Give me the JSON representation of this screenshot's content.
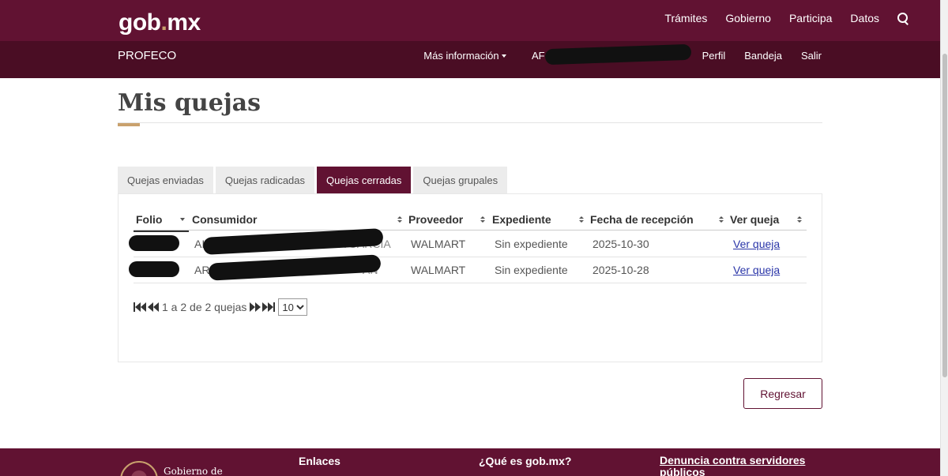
{
  "header": {
    "logo_main": "gob",
    "logo_dot": ".",
    "logo_tld": "mx",
    "nav": [
      "Trámites",
      "Gobierno",
      "Participa",
      "Datos"
    ],
    "search_icon": "search-icon"
  },
  "subheader": {
    "brand": "PROFECO",
    "mas_info": "Más información",
    "user_prefix": "AF",
    "items": [
      "Perfil",
      "Bandeja",
      "Salir"
    ]
  },
  "page": {
    "title": "Mis quejas"
  },
  "tabs": [
    {
      "label": "Quejas enviadas",
      "active": false
    },
    {
      "label": "Quejas radicadas",
      "active": false
    },
    {
      "label": "Quejas cerradas",
      "active": true
    },
    {
      "label": "Quejas grupales",
      "active": false
    }
  ],
  "table": {
    "headers": [
      "Folio",
      "Consumidor",
      "Proveedor",
      "Expediente",
      "Fecha de recepción",
      "Ver queja"
    ],
    "rows": [
      {
        "folio": "",
        "consumidor_prefix": "AI",
        "consumidor_suffix": "ANDA GARCIA",
        "proveedor": "WALMART",
        "expediente": "Sin expediente",
        "fecha": "2025-10-30",
        "ver": "Ver queja"
      },
      {
        "folio": "",
        "consumidor_prefix": "AR",
        "consumidor_suffix": "AN",
        "proveedor": "WALMART",
        "expediente": "Sin expediente",
        "fecha": "2025-10-28",
        "ver": "Ver queja"
      }
    ]
  },
  "pagination": {
    "summary": "1 a 2 de 2 quejas",
    "page_size": "10",
    "page_size_options": [
      "10"
    ]
  },
  "actions": {
    "back_label": "Regresar"
  },
  "footer": {
    "gob_de": "Gobierno de",
    "col1": "Enlaces",
    "col2": "¿Qué es gob.mx?",
    "col3": "Denuncia contra servidores públicos"
  },
  "colors": {
    "primary": "#611232",
    "primary_dark": "#4a0d24",
    "accent": "#c9a16d",
    "link": "#2a35a8"
  }
}
